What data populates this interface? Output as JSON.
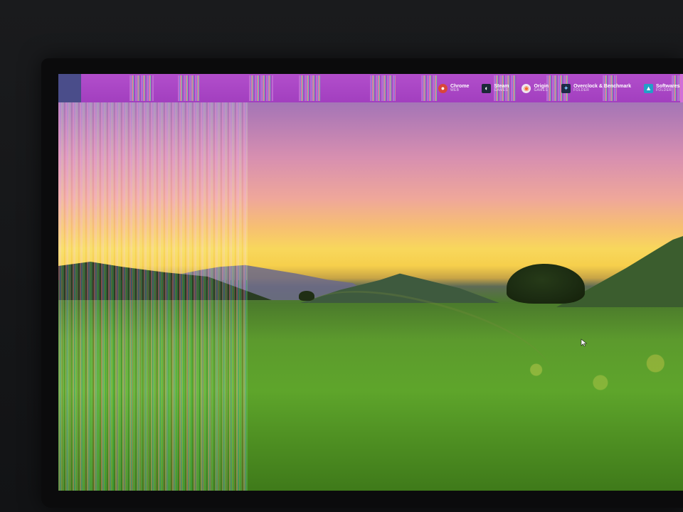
{
  "taskbar": {
    "tiles": [
      {
        "name": "Chrome",
        "category": "WEB",
        "icon": "chrome-icon",
        "color": "#d9463a"
      },
      {
        "name": "Steam",
        "category": "GAMES",
        "icon": "steam-icon",
        "color": "#1b2838"
      },
      {
        "name": "Origin",
        "category": "GAMES",
        "icon": "origin-icon",
        "color": "#f56c2d"
      },
      {
        "name": "Overclock & Benchmark",
        "category": "FOLDER",
        "icon": "overclock-icon",
        "color": "#2a6bd8"
      },
      {
        "name": "Softwares",
        "category": "FOLDER",
        "icon": "softwares-icon",
        "color": "#23a0c8"
      }
    ]
  },
  "colors": {
    "taskbar": "#a23fbf",
    "bezel": "#0b0b0c"
  }
}
